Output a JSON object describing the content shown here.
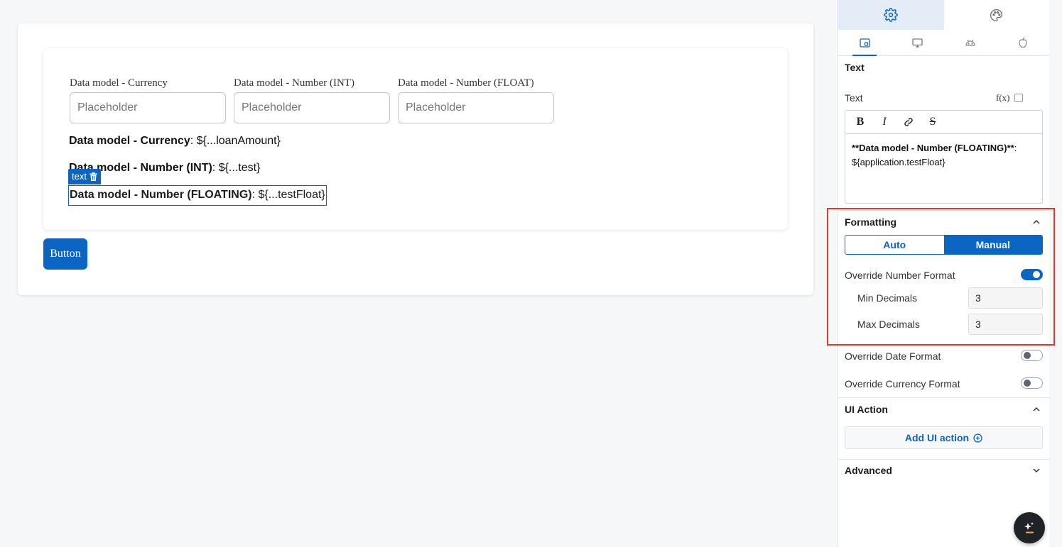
{
  "canvas": {
    "fields": [
      {
        "label": "Data model - Currency",
        "placeholder": "Placeholder"
      },
      {
        "label": "Data model - Number (INT)",
        "placeholder": "Placeholder"
      },
      {
        "label": "Data model - Number (FLOAT)",
        "placeholder": "Placeholder"
      }
    ],
    "texts": [
      {
        "bold": "Data model - Currency",
        "rest": ": ${...loanAmount}"
      },
      {
        "bold": "Data model - Number (INT)",
        "rest": ": ${...test}"
      },
      {
        "bold": "Data model - Number (FLOATING)",
        "rest": ": ${...testFloat}"
      }
    ],
    "selection_tag": "text",
    "button_label": "Button"
  },
  "panel": {
    "tabs": [
      {
        "icon": "gear-icon",
        "active": true
      },
      {
        "icon": "palette-icon",
        "active": false
      }
    ],
    "device_tabs": [
      {
        "icon": "tablet-icon",
        "active": true
      },
      {
        "icon": "desktop-icon",
        "active": false
      },
      {
        "icon": "android-icon",
        "active": false
      },
      {
        "icon": "apple-icon",
        "active": false
      }
    ],
    "text_section": {
      "title": "Text",
      "text_label": "Text",
      "fx_label": "f(x)",
      "toolbar": [
        "B",
        "I",
        "link",
        "S"
      ],
      "content_bold": "**Data model - Number (FLOATING)**",
      "content_rest": ":",
      "content_line2": "${application.testFloat}"
    },
    "formatting": {
      "title": "Formatting",
      "mode_auto": "Auto",
      "mode_manual": "Manual",
      "selected_mode": "Manual",
      "override_number": {
        "label": "Override Number Format",
        "on": true
      },
      "min_decimals": {
        "label": "Min Decimals",
        "value": "3"
      },
      "max_decimals": {
        "label": "Max Decimals",
        "value": "3"
      },
      "override_date": {
        "label": "Override Date Format",
        "on": false
      },
      "override_currency": {
        "label": "Override Currency Format",
        "on": false
      }
    },
    "ui_action": {
      "title": "UI Action",
      "add_label": "Add UI action"
    },
    "advanced": {
      "title": "Advanced"
    }
  },
  "colors": {
    "accent": "#0a66c2",
    "highlight": "#e0392b"
  }
}
